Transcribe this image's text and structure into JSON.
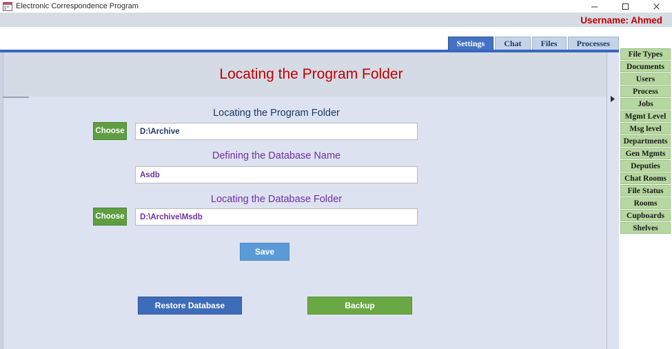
{
  "window": {
    "title": "Electronic Correspondence Program",
    "icon": "database-window-icon",
    "minimize_label": "─",
    "maximize_label": "❐",
    "close_label": "✕"
  },
  "userband": {
    "username_text": "Username: Ahmed"
  },
  "tabs": [
    {
      "label": "Settings",
      "active": true
    },
    {
      "label": "Chat",
      "active": false
    },
    {
      "label": "Files",
      "active": false
    },
    {
      "label": "Processes",
      "active": false
    }
  ],
  "form": {
    "header_title": "Locating the Program Folder",
    "expander_icon": "chevron-right-icon",
    "sections": [
      {
        "label": "Locating the Program Folder",
        "label_color": "#1f3864",
        "choose_label": "Choose",
        "value": "D:\\Archive",
        "placeholder": ""
      },
      {
        "label": "Defining the Database Name",
        "label_color": "#7030a0",
        "choose_label": "",
        "value": "Asdb",
        "placeholder": ""
      },
      {
        "label": "Locating the Database Folder",
        "label_color": "#7030a0",
        "choose_label": "Choose",
        "value": "D:\\Archive\\Msdb",
        "placeholder": ""
      }
    ],
    "save_label": "Save",
    "restore_label": "Restore Database",
    "backup_label": "Backup"
  },
  "sidebar": {
    "items": [
      {
        "label": "File Types"
      },
      {
        "label": "Documents"
      },
      {
        "label": "Users"
      },
      {
        "label": "Process"
      },
      {
        "label": "Jobs"
      },
      {
        "label": "Mgmt Level"
      },
      {
        "label": "Msg level"
      },
      {
        "label": "Departments"
      },
      {
        "label": "Gen Mgmts"
      },
      {
        "label": "Deputies"
      },
      {
        "label": "Chat Rooms"
      },
      {
        "label": "File Status"
      },
      {
        "label": "Rooms"
      },
      {
        "label": "Cupboards"
      },
      {
        "label": "Shelves"
      }
    ]
  },
  "colors": {
    "accent_blue": "#3a66c0",
    "tab_active": "#4472c4",
    "username_red": "#c00000",
    "title_red": "#c00000",
    "choose_green": "#5f9e41",
    "sidebar_green": "#b6d7a0",
    "save_blue": "#5b9bd5",
    "restore_blue": "#3d6cb9",
    "backup_green": "#6aa844",
    "label_navy": "#1f3864",
    "label_purple": "#7030a0",
    "form_bg": "#dce2f0",
    "header_bg": "#d5dbe5"
  }
}
